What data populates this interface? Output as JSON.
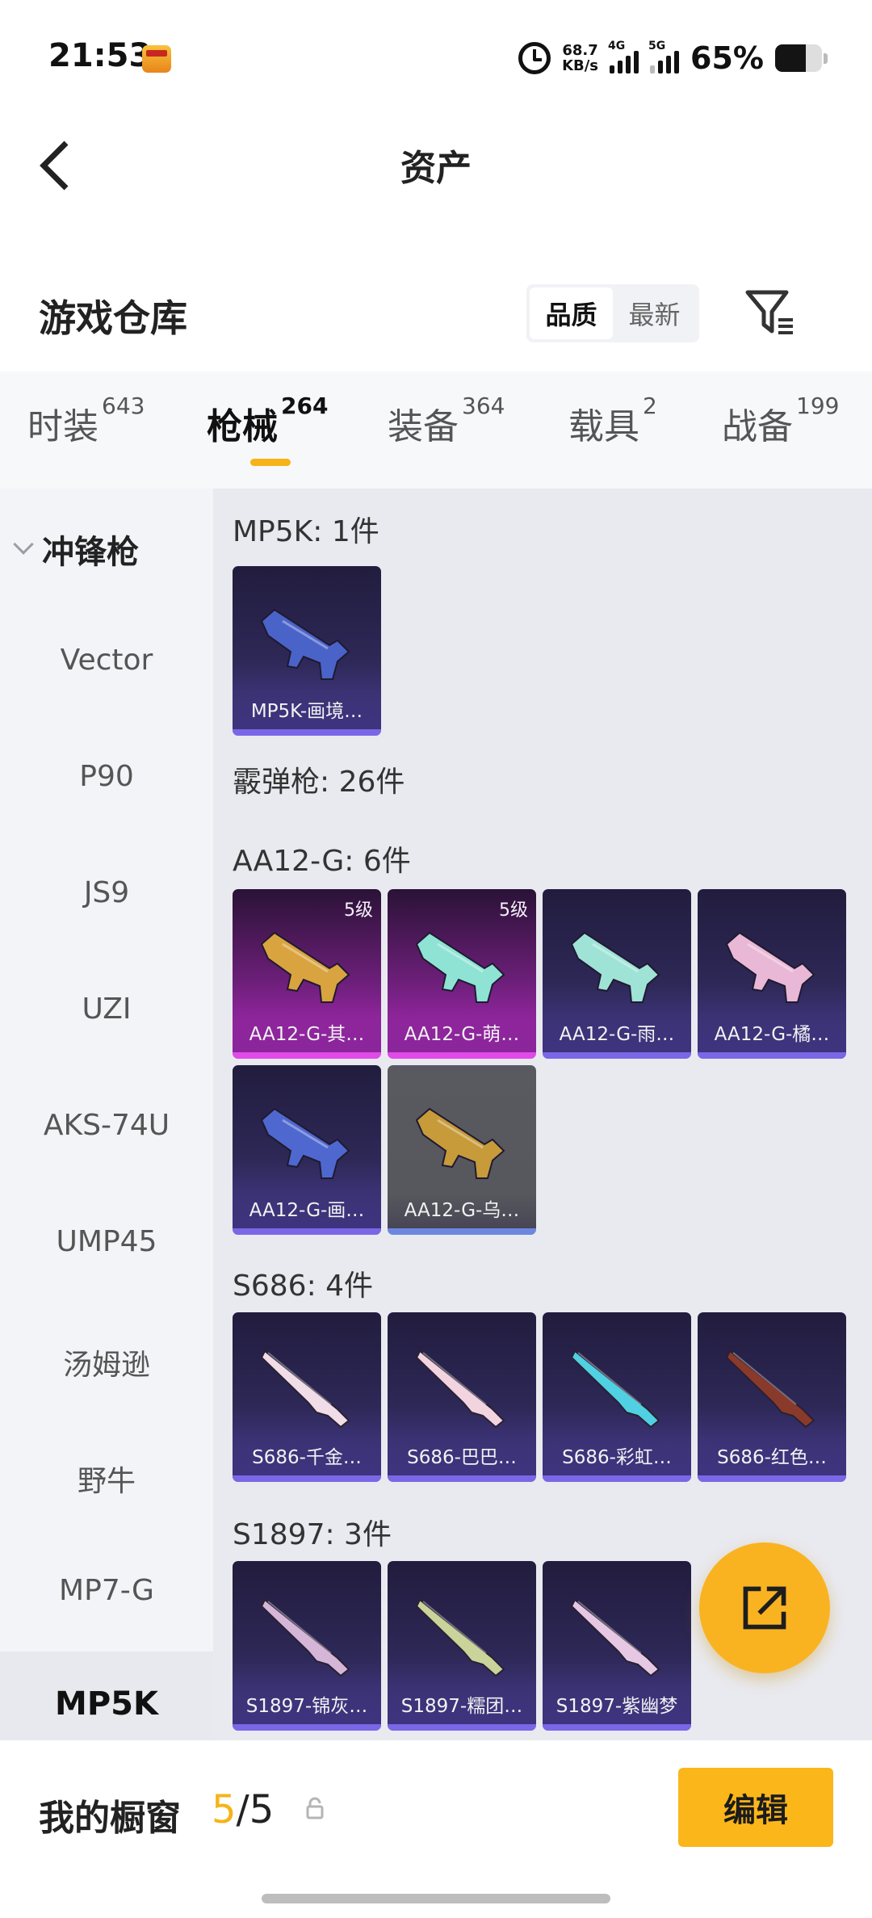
{
  "status_bar": {
    "time": "21:53",
    "net_speed_value": "68.7",
    "net_speed_unit": "KB/s",
    "sim1": "4G",
    "sim2": "5G",
    "battery_text": "65%",
    "battery_level": 0.65
  },
  "header": {
    "title": "资产"
  },
  "warehouse": {
    "title": "游戏仓库",
    "sort_options": [
      "品质",
      "最新"
    ],
    "sort_selected": "品质"
  },
  "tabs": [
    {
      "label": "时装",
      "count": "643"
    },
    {
      "label": "枪械",
      "count": "264",
      "active": true
    },
    {
      "label": "装备",
      "count": "364"
    },
    {
      "label": "载具",
      "count": "2"
    },
    {
      "label": "战备",
      "count": "199"
    }
  ],
  "sidebar": {
    "category": "冲锋枪",
    "items": [
      "Vector",
      "P90",
      "JS9",
      "UZI",
      "AKS-74U",
      "UMP45",
      "汤姆逊",
      "野牛",
      "MP7-G",
      "MP5K"
    ],
    "selected": "MP5K"
  },
  "main": {
    "sections": [
      {
        "label": "MP5K: 1件",
        "cards": [
          {
            "name": "MP5K-画境…",
            "rarity": "purple",
            "gun_color": "#4a63c9"
          }
        ]
      },
      {
        "label": "霰弹枪: 26件",
        "cards": []
      },
      {
        "label": "AA12-G: 6件",
        "cards": [
          {
            "name": "AA12-G-其…",
            "rarity": "gold",
            "level": "5级",
            "gun_color": "#d9a43f"
          },
          {
            "name": "AA12-G-萌…",
            "rarity": "gold",
            "level": "5级",
            "gun_color": "#8fe3d4"
          },
          {
            "name": "AA12-G-雨…",
            "rarity": "purple",
            "gun_color": "#9fe3d7"
          },
          {
            "name": "AA12-G-橘…",
            "rarity": "purple",
            "gun_color": "#e9b8d6"
          },
          {
            "name": "AA12-G-画…",
            "rarity": "purple",
            "gun_color": "#4f68cf"
          },
          {
            "name": "AA12-G-乌…",
            "rarity": "grey",
            "gun_color": "#c79a3a"
          }
        ]
      },
      {
        "label": "S686: 4件",
        "cards": [
          {
            "name": "S686-千金…",
            "rarity": "purple",
            "gun_color": "#f0dde8"
          },
          {
            "name": "S686-巴巴…",
            "rarity": "purple",
            "gun_color": "#f2d3e0"
          },
          {
            "name": "S686-彩虹…",
            "rarity": "purple",
            "gun_color": "#4fd1e3"
          },
          {
            "name": "S686-红色…",
            "rarity": "purple",
            "gun_color": "#8a3a2a"
          }
        ]
      },
      {
        "label": "S1897: 3件",
        "cards": [
          {
            "name": "S1897-锦灰…",
            "rarity": "purple",
            "gun_color": "#d6b6d8"
          },
          {
            "name": "S1897-糯团…",
            "rarity": "purple",
            "gun_color": "#c9d39a"
          },
          {
            "name": "S1897-紫幽梦",
            "rarity": "purple",
            "gun_color": "#e6c8e4"
          }
        ]
      }
    ]
  },
  "bottom": {
    "showcase_label": "我的橱窗",
    "showcase_current": "5",
    "showcase_total": "/5",
    "edit_label": "编辑"
  },
  "colors": {
    "accent": "#f5b417",
    "purple_card": "#2d2856",
    "gold_card": "#b42cc0"
  }
}
